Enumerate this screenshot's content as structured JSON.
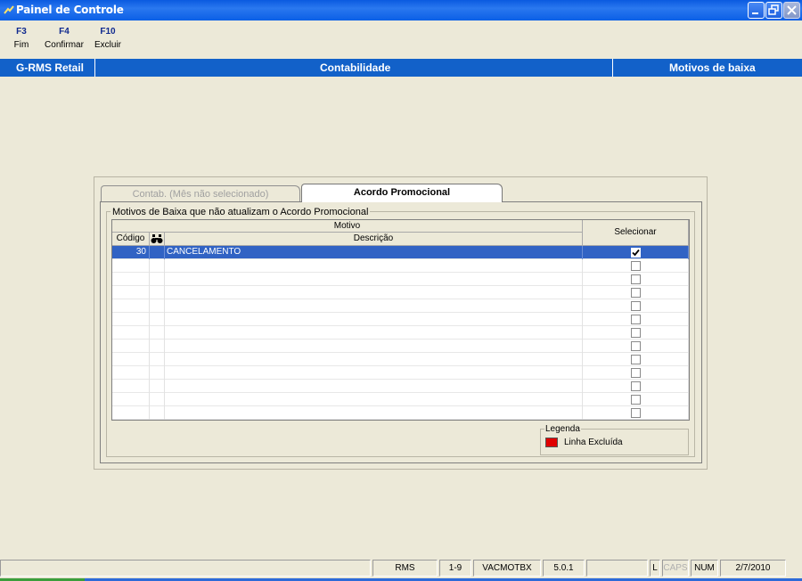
{
  "window": {
    "title": "Painel de Controle"
  },
  "toolbar": {
    "keys": [
      {
        "key": "F3",
        "label": "Fim"
      },
      {
        "key": "F4",
        "label": "Confirmar"
      },
      {
        "key": "F10",
        "label": "Excluir"
      }
    ]
  },
  "header": {
    "app": "G-RMS Retail",
    "module": "Contabilidade",
    "screen": "Motivos de baixa"
  },
  "tabs": [
    {
      "label": "Contab. (Mês não selecionado)",
      "active": false
    },
    {
      "label": "Acordo Promocional",
      "active": true
    }
  ],
  "group": {
    "title": "Motivos de Baixa que  não atualizam o Acordo Promocional"
  },
  "grid": {
    "header_group": "Motivo",
    "col_code": "Código",
    "col_desc": "Descrição",
    "col_select": "Selecionar",
    "rows": [
      {
        "code": "30",
        "desc": "CANCELAMENTO",
        "checked": true,
        "selected": true
      },
      {
        "code": "",
        "desc": "",
        "checked": false
      },
      {
        "code": "",
        "desc": "",
        "checked": false
      },
      {
        "code": "",
        "desc": "",
        "checked": false
      },
      {
        "code": "",
        "desc": "",
        "checked": false
      },
      {
        "code": "",
        "desc": "",
        "checked": false
      },
      {
        "code": "",
        "desc": "",
        "checked": false
      },
      {
        "code": "",
        "desc": "",
        "checked": false
      },
      {
        "code": "",
        "desc": "",
        "checked": false
      },
      {
        "code": "",
        "desc": "",
        "checked": false
      },
      {
        "code": "",
        "desc": "",
        "checked": false
      },
      {
        "code": "",
        "desc": "",
        "checked": false
      },
      {
        "code": "",
        "desc": "",
        "checked": false
      },
      {
        "code": "",
        "desc": "",
        "checked": false
      }
    ]
  },
  "legend": {
    "title": "Legenda",
    "item": "Linha Excluída",
    "color": "#e00000"
  },
  "statusbar": {
    "system": "RMS",
    "range": "1-9",
    "program": "VACMOTBX",
    "version": "5.0.1",
    "l": "L",
    "caps": "CAPS",
    "num": "NUM",
    "date": "2/7/2010"
  },
  "colors": {
    "titlebar": "#0b5fe6",
    "header": "#1261c9",
    "selected_row": "#3163c4"
  }
}
